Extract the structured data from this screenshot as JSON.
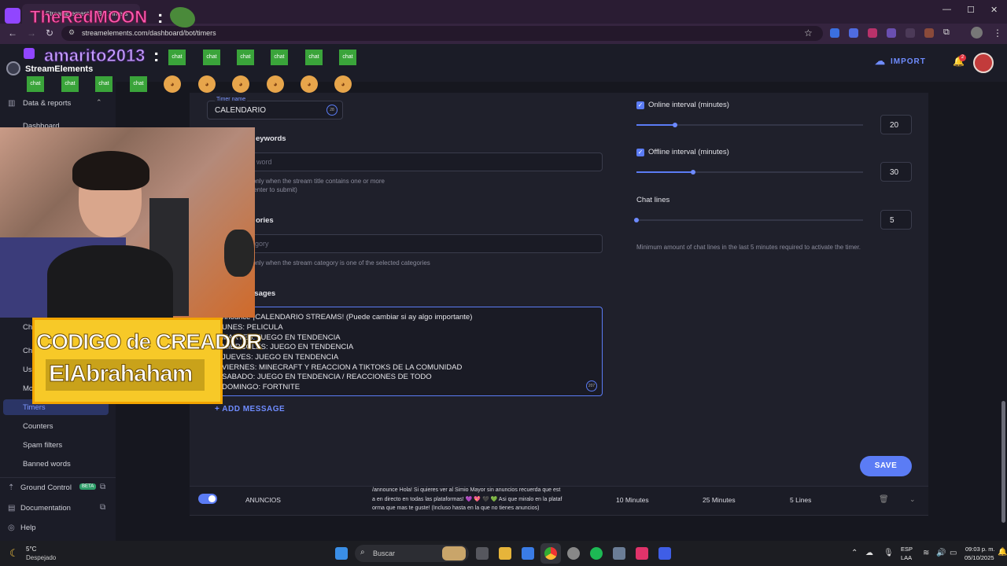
{
  "browser": {
    "tab_title": "StreamElements - Bot Timers",
    "url": "streamelements.com/dashboard/bot/timers",
    "window_controls": [
      "—",
      "☐",
      "✕"
    ]
  },
  "stream_overlay": {
    "channel_name": "TheRedMOON",
    "chat_user": "amarito2013",
    "emote_label": "chat",
    "creator_code_title": "CODIGO de CREADOR",
    "creator_code_value": "ElAbrahaham"
  },
  "header": {
    "brand": "StreamElements",
    "import_label": "IMPORT",
    "notification_count": "2"
  },
  "sidebar": {
    "section_data": "Data & reports",
    "dashboard": "Dashboard",
    "items_partial": [
      "Ch",
      "Ch",
      "Us",
      "Mo"
    ],
    "items": [
      {
        "label": "Timers",
        "active": true
      },
      {
        "label": "Counters",
        "active": false
      },
      {
        "label": "Spam filters",
        "active": false
      },
      {
        "label": "Banned words",
        "active": false
      }
    ],
    "ground_control": "Ground Control",
    "beta": "BETA",
    "documentation": "Documentation",
    "help": "Help"
  },
  "form": {
    "timer_name_label": "Timer name",
    "timer_name_value": "CALENDARIO",
    "timer_name_count": "28",
    "keywords_label": "eywords",
    "keywords_placeholder": "word",
    "keywords_hint_1": "r only when the stream title contains one or more",
    "keywords_hint_2": "s enter to submit)",
    "categories_label": "ories",
    "categories_placeholder": "gory",
    "categories_hint": "r only when the stream category is one of the selected categories",
    "messages_label": "ssages",
    "message_lines": [
      "nnounce ¡CALENDARIO STREAMS! (Puede cambiar si ay algo importante)",
      "UNES: PELICULA",
      "MARTES: JUEGO EN TENDENCIA",
      "MIERCOLES: JUEGO EN TENDENCIA",
      "JUEVES: JUEGO EN TENDENCIA",
      "VIERNES: MINECRAFT Y REACCION A TIKTOKS DE LA COMUNIDAD",
      "SABADO: JUEGO EN TENDENCIA / REACCIONES DE TODO",
      "DOMINGO: FORTNITE"
    ],
    "message_count": "207",
    "add_message": "+ ADD MESSAGE",
    "online_label": "Online interval (minutes)",
    "online_value": "20",
    "online_fill": 0.17,
    "offline_label": "Offline interval (minutes)",
    "offline_value": "30",
    "offline_fill": 0.25,
    "chat_lines_label": "Chat lines",
    "chat_lines_value": "5",
    "chat_lines_fill": 0.0,
    "chat_lines_hint": "Minimum amount of chat lines in the last 5 minutes required to activate the timer.",
    "save_label": "SAVE"
  },
  "timer_row": {
    "name": "ANUNCIOS",
    "message_1": "/announce Hola! Si quieres ver al Simio Mayor sin anuncios recuerda que est",
    "message_2": "a en directo en todas las plataformas! 💜 💖 🖤 💚  Asi que miralo en la plataf",
    "message_3": "orma que mas te guste! (Incluso hasta en la que no tienes anuncios)",
    "online": "10 Minutes",
    "offline": "25 Minutes",
    "lines": "5 Lines",
    "enabled": true
  },
  "taskbar": {
    "temp": "5°C",
    "weather": "Despejado",
    "search": "Buscar",
    "lang_1": "ESP",
    "lang_2": "LAA",
    "time": "09:03 p. m.",
    "date": "05/10/2025"
  }
}
